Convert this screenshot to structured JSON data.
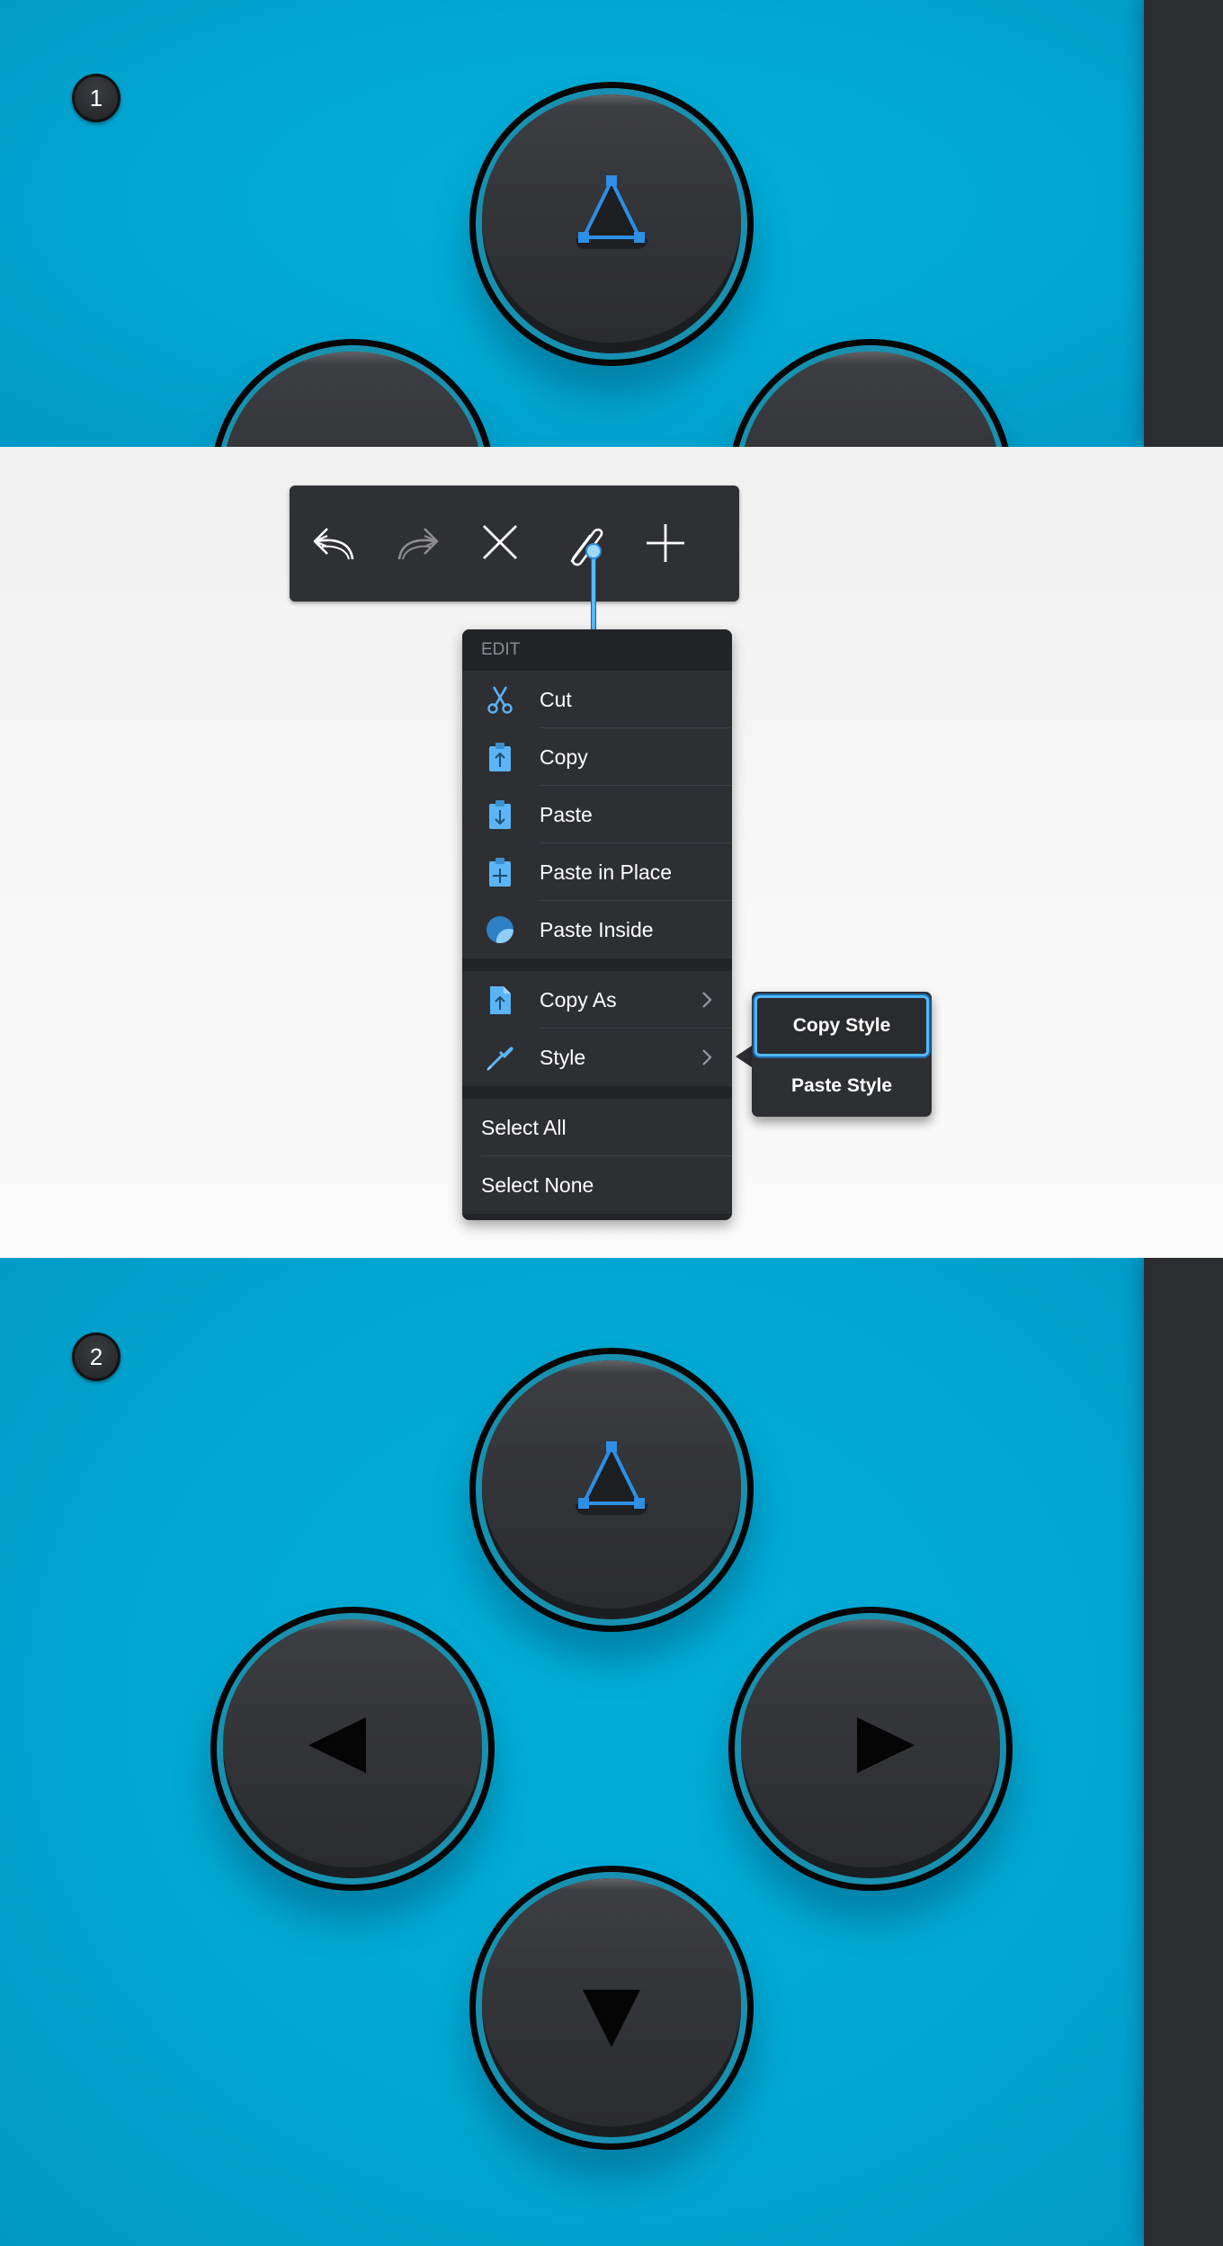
{
  "steps": {
    "step1_label": "1",
    "step2_label": "2"
  },
  "colors": {
    "canvas_background": "#02a7d2",
    "side_panel": "#2c2d30",
    "button_face": "#35363a",
    "button_rim": "#1891b0",
    "selection_accent": "#2d8fe6",
    "menu_background": "#2e2f33"
  },
  "toolbar": {
    "buttons": [
      {
        "name": "undo",
        "icon": "undo-arrow-icon",
        "enabled": true
      },
      {
        "name": "redo",
        "icon": "redo-arrow-icon",
        "enabled": false
      },
      {
        "name": "delete",
        "icon": "close-x-icon",
        "enabled": true
      },
      {
        "name": "edit",
        "icon": "paperclip-icon",
        "enabled": true,
        "active": true
      },
      {
        "name": "add",
        "icon": "plus-icon",
        "enabled": true
      }
    ]
  },
  "edit_menu": {
    "header": "EDIT",
    "items": [
      {
        "label": "Cut",
        "icon": "scissors-icon"
      },
      {
        "label": "Copy",
        "icon": "clipboard-up-icon"
      },
      {
        "label": "Paste",
        "icon": "clipboard-down-icon"
      },
      {
        "label": "Paste in Place",
        "icon": "clipboard-plus-icon"
      },
      {
        "label": "Paste Inside",
        "icon": "paste-inside-icon"
      },
      {
        "label": "Copy As",
        "icon": "document-up-icon",
        "submenu": true
      },
      {
        "label": "Style",
        "icon": "eyedropper-icon",
        "submenu": true
      },
      {
        "label": "Select All"
      },
      {
        "label": "Select None"
      }
    ]
  },
  "style_submenu": {
    "items": [
      {
        "label": "Copy Style",
        "highlighted": true
      },
      {
        "label": "Paste Style"
      }
    ]
  },
  "gamepad": {
    "top_button_icon": "triangle-selected-icon",
    "left_button_icon": "arrow-left-icon",
    "right_button_icon": "arrow-right-icon",
    "down_button_icon": "arrow-down-icon"
  }
}
